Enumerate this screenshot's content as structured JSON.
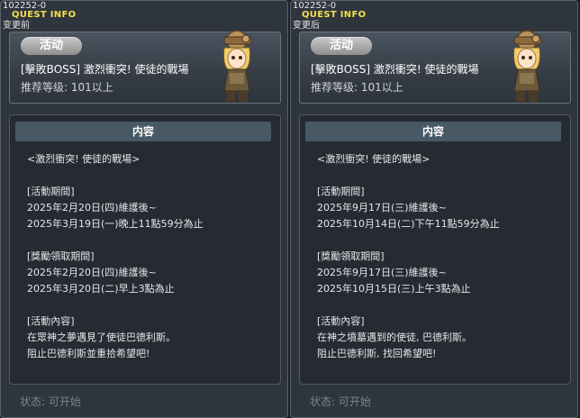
{
  "panels": [
    {
      "quest_id": "102252-0",
      "quest_info": "QUEST INFO",
      "note": "变更前",
      "badge": "活动",
      "title": "[擊敗BOSS] 激烈衝突! 使徒的戰場",
      "level": "推荐等级: 101以上",
      "content_tab": "内容",
      "lines": [
        "<激烈衝突! 使徒的戰場>",
        "",
        "[活動期間]",
        "2025年2月20日(四)維護後~",
        "2025年3月19日(一)晚上11點59分為止",
        "",
        "[獎勵領取期間]",
        "2025年2月20日(四)維護後~",
        "2025年3月20日(二)早上3點為止",
        "",
        "[活動內容]",
        "在眾神之夢遇見了使徒巴德利斯。",
        "阻止巴德利斯並重拾希望吧!"
      ],
      "status": "状态:  可开始"
    },
    {
      "quest_id": "102252-0",
      "quest_info": "QUEST INFO",
      "note": "变更后",
      "badge": "活动",
      "title": "[擊敗BOSS] 激烈衝突! 使徒的戰場",
      "level": "推荐等级: 101以上",
      "content_tab": "内容",
      "lines": [
        "<激烈衝突! 使徒的戰場>",
        "",
        "[活動期間]",
        "2025年9月17日(三)維護後~",
        "2025年10月14日(二)下午11點59分為止",
        "",
        "[獎勵領取期間]",
        "2025年9月17日(三)維護後~",
        "2025年10月15日(三)上午3點為止",
        "",
        "[活動內容]",
        "在神之墳墓遇到的使徒, 巴德利斯。",
        "阻止巴德利斯, 找回希望吧!"
      ],
      "status": "状态:  可开始"
    }
  ]
}
